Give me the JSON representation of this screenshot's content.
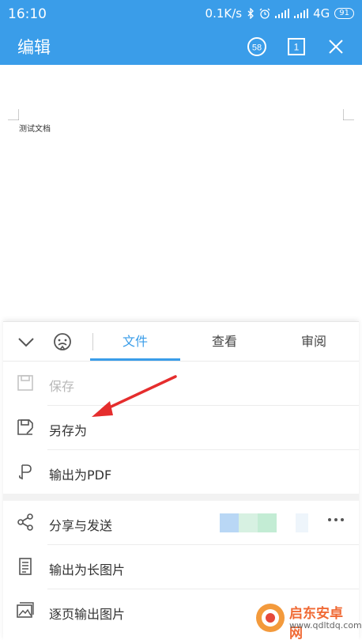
{
  "colors": {
    "primary": "#3a9de9",
    "arrow": "#e52d2d",
    "disabled": "#b8b8b8"
  },
  "status_bar": {
    "time": "16:10",
    "net_speed": "0.1K/s",
    "network": "4G",
    "battery": "91",
    "icons": [
      "bluetooth-icon",
      "alarm-icon",
      "signal-icon",
      "signal-icon",
      "battery-icon"
    ]
  },
  "app_bar": {
    "title": "编辑",
    "badge_count": "58",
    "page_count": "1",
    "icons": [
      "counter-icon",
      "page-icon",
      "close-icon"
    ]
  },
  "document": {
    "text": "测试文档"
  },
  "panel": {
    "tabs": [
      {
        "label": "文件",
        "active": true
      },
      {
        "label": "查看",
        "active": false
      },
      {
        "label": "审阅",
        "active": false
      }
    ],
    "menu": [
      {
        "label": "保存",
        "icon": "save-icon",
        "disabled": true
      },
      {
        "label": "另存为",
        "icon": "save-as-icon",
        "disabled": false
      },
      {
        "label": "输出为PDF",
        "icon": "pdf-icon",
        "disabled": false
      },
      {
        "label": "分享与发送",
        "icon": "share-icon",
        "disabled": false
      },
      {
        "label": "输出为长图片",
        "icon": "long-image-icon",
        "disabled": false
      },
      {
        "label": "逐页输出图片",
        "icon": "image-icon",
        "disabled": false
      }
    ]
  },
  "watermark": {
    "brand": "启东安卓网",
    "url": "www.qdltdq.com"
  }
}
